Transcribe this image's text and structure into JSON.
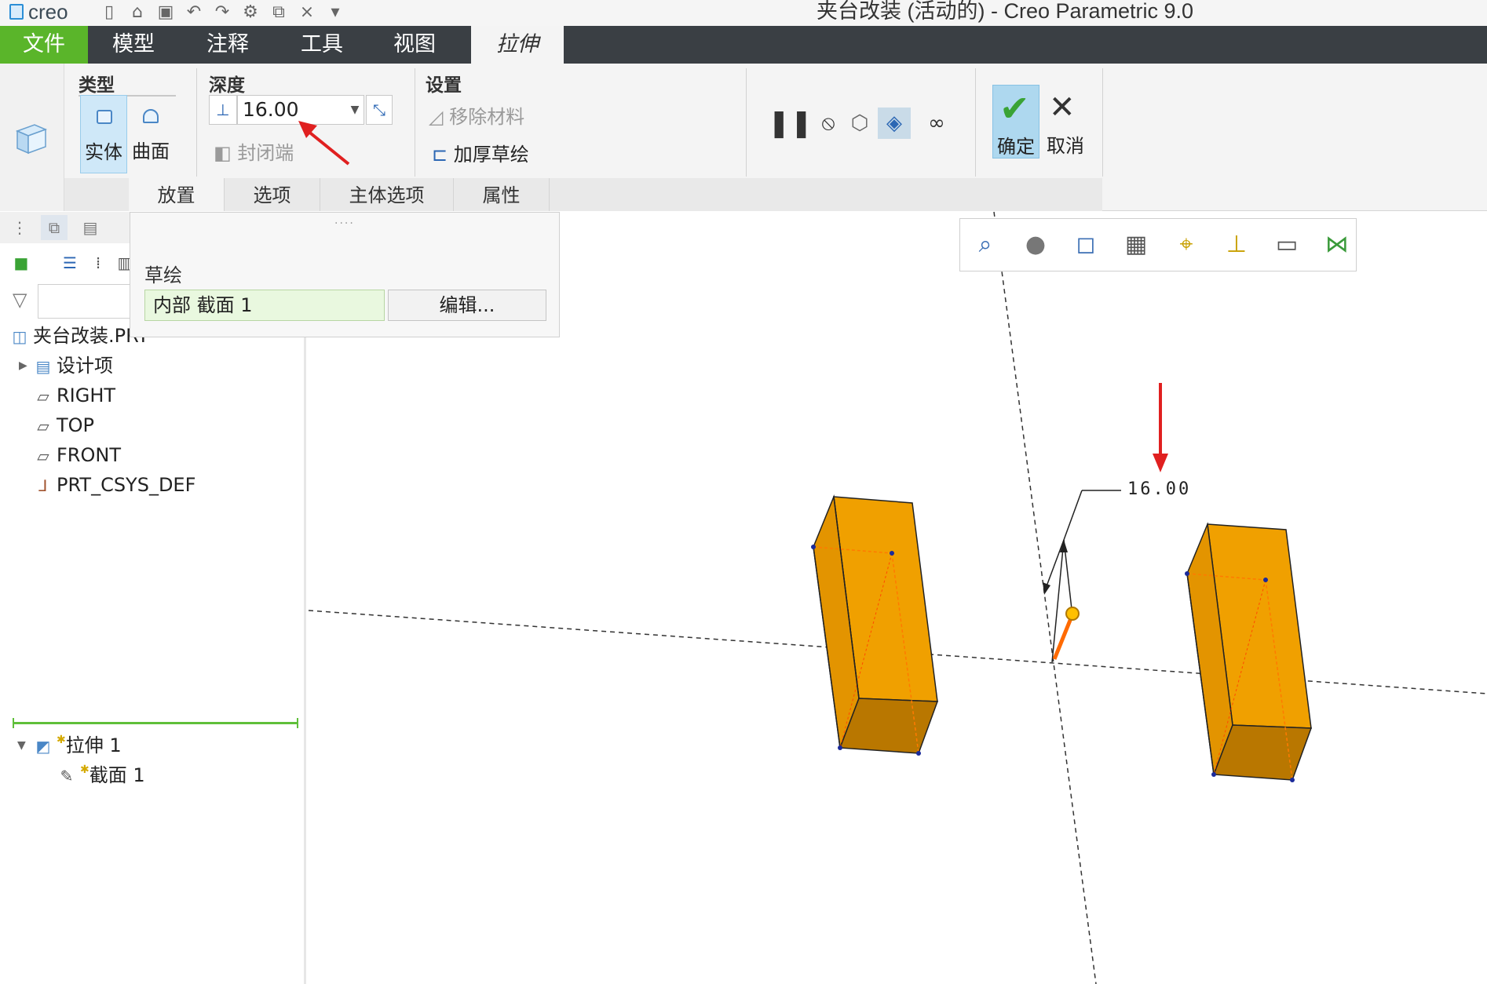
{
  "app": {
    "logo": "creo",
    "window_title": "夹台改装 (活动的) - Creo Parametric 9.0"
  },
  "ribbon_tabs": {
    "file": "文件",
    "model": "模型",
    "annotate": "注释",
    "tools": "工具",
    "view": "视图",
    "extrude": "拉伸"
  },
  "ribbon": {
    "type_group": "类型",
    "solid": "实体",
    "surface": "曲面",
    "depth_group": "深度",
    "depth_value": "16.00",
    "capped_ends": "封闭端",
    "settings_group": "设置",
    "remove_material": "移除材料",
    "thicken_sketch": "加厚草绘",
    "ok": "确定",
    "cancel": "取消"
  },
  "sub_tabs": {
    "placement": "放置",
    "options": "选项",
    "body_options": "主体选项",
    "properties": "属性"
  },
  "placement_panel": {
    "label": "草绘",
    "sketch_value": "内部 截面 1",
    "edit_button": "编辑..."
  },
  "model_tree": {
    "root": "夹台改装.PRT",
    "design_items": "设计项",
    "right": "RIGHT",
    "top": "TOP",
    "front": "FRONT",
    "csys": "PRT_CSYS_DEF",
    "extrude": "拉伸 1",
    "section": "截面 1"
  },
  "graphics": {
    "dimension_label": "16.00",
    "solid_color": "#f0a000",
    "annotation_arrow_color": "#e02020"
  },
  "icons": {
    "pause": "pause-icon",
    "no_preview": "stop-icon",
    "geometry_preview": "preview-icon",
    "verify": "verify-icon",
    "glasses": "glasses-icon"
  }
}
